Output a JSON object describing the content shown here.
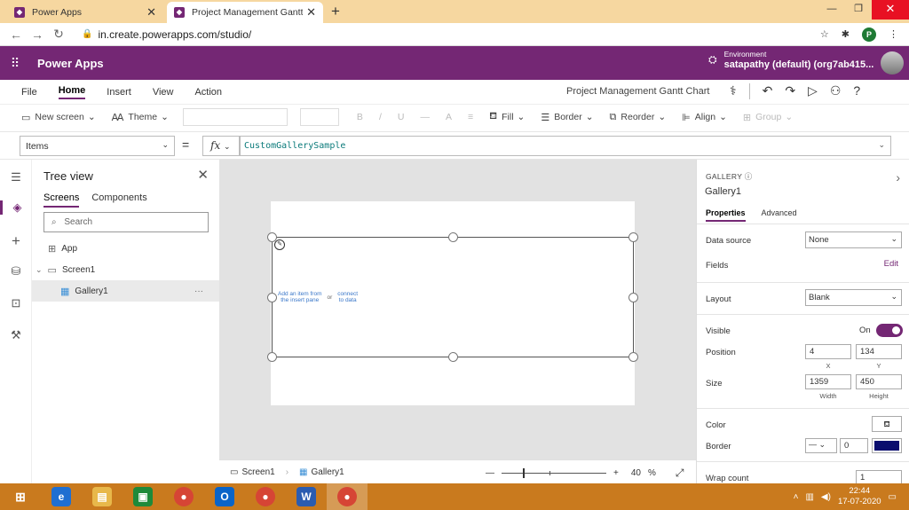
{
  "browser": {
    "tabs": [
      {
        "label": "Power Apps"
      },
      {
        "label": "Project Management Gantt Chart"
      }
    ],
    "url": "in.create.powerapps.com/studio/",
    "profile_initial": "P"
  },
  "app": {
    "brand": "Power Apps",
    "environment_label": "Environment",
    "environment_value": "satapathy (default) (org7ab415..."
  },
  "menu": {
    "items": [
      "File",
      "Home",
      "Insert",
      "View",
      "Action"
    ],
    "active": "Home",
    "app_name": "Project Management Gantt Chart"
  },
  "ribbon": {
    "new_screen": "New screen",
    "theme": "Theme",
    "bold": "B",
    "italic": "/",
    "underline": "U",
    "strike": "—",
    "font_color": "A",
    "align_text": "≡",
    "fill": "Fill",
    "border": "Border",
    "reorder": "Reorder",
    "align": "Align",
    "group": "Group"
  },
  "formula": {
    "property": "Items",
    "equals": "=",
    "fx": "fx",
    "value": "CustomGallerySample"
  },
  "tree": {
    "title": "Tree view",
    "tabs": [
      "Screens",
      "Components"
    ],
    "active_tab": "Screens",
    "search_placeholder": "Search",
    "items": [
      {
        "label": "App"
      },
      {
        "label": "Screen1"
      },
      {
        "label": "Gallery1"
      }
    ],
    "more": "···"
  },
  "canvas": {
    "hint_insert_line1": "Add an item from",
    "hint_insert_line2": "the insert pane",
    "hint_or": "or",
    "hint_connect_line1": "connect",
    "hint_connect_line2": "to data"
  },
  "bottombar": {
    "screen": "Screen1",
    "gallery": "Gallery1",
    "zoom_minus": "—",
    "zoom_plus": "+",
    "zoom_value": "40",
    "zoom_unit": "%"
  },
  "properties": {
    "type": "GALLERY",
    "name": "Gallery1",
    "tabs": [
      "Properties",
      "Advanced"
    ],
    "active_tab": "Properties",
    "data_source_label": "Data source",
    "data_source_value": "None",
    "fields_label": "Fields",
    "fields_edit": "Edit",
    "layout_label": "Layout",
    "layout_value": "Blank",
    "visible_label": "Visible",
    "visible_value": "On",
    "position_label": "Position",
    "position_x": "4",
    "position_y": "134",
    "position_x_label": "X",
    "position_y_label": "Y",
    "size_label": "Size",
    "size_width": "1359",
    "size_height": "450",
    "size_width_label": "Width",
    "size_height_label": "Height",
    "color_label": "Color",
    "border_label": "Border",
    "border_thickness": "0",
    "border_color": "#0a0d6e",
    "wrap_count_label": "Wrap count",
    "wrap_count_value": "1"
  },
  "taskbar": {
    "time": "22:44",
    "date": "17-07-2020"
  },
  "colors": {
    "accent": "#742774",
    "tabstrip": "#f6d7a0",
    "taskbar": "#c97a1e"
  }
}
